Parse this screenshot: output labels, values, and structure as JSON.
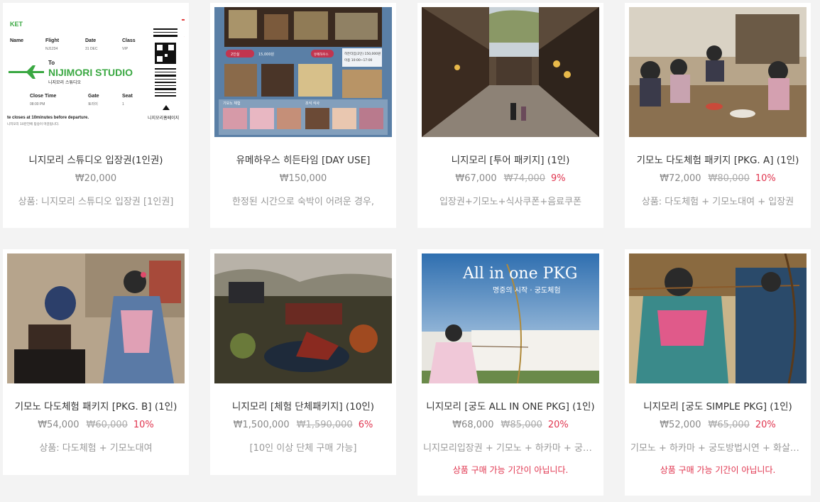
{
  "products": [
    {
      "title": "니지모리 스튜디오 입장권(1인권)",
      "price": "₩20,000",
      "original_price": "",
      "discount": "",
      "description": "상품: 니지모리 스튜디오 입장권 [1인권]",
      "notice": "",
      "image": {
        "ticket_header": "KET",
        "labels": [
          "Name",
          "Flight",
          "Date",
          "Class"
        ],
        "values": [
          "NJ1234",
          "31 DEC",
          "VIP"
        ],
        "to_label": "To",
        "studio_name": "NIJIMORI STUDIO",
        "studio_name_kr": "니지모리 스튜디오",
        "labels2": [
          "Close Time",
          "Gate",
          "Seat"
        ],
        "values2": [
          "08:00 PM",
          "토리이",
          "1"
        ],
        "footer": "te closes at 10minutes before departure.",
        "footer2": "니지모리 10분전에 탑승이 마감됩니다.",
        "qr_caption": "니지모리홈페이지"
      }
    },
    {
      "title": "유메하우스 히든타임 [DAY USE]",
      "price": "₩150,000",
      "original_price": "",
      "discount": "",
      "description": "한정된 시간으로 숙박이 어려운 경우,",
      "notice": "",
      "image": {
        "tag1": "2인실",
        "tag1_price": "15,000원",
        "tag2": "유메하우스",
        "info_line1": "히든타임(2인) 150,000원",
        "info_line2": "이용 10:00~17:00",
        "section1": "기모노 체험",
        "section2": "조식 식사"
      }
    },
    {
      "title": "니지모리 [투어 패키지] (1인)",
      "price": "₩67,000",
      "original_price": "₩74,000",
      "discount": "9%",
      "description": "입장권+기모노+식사쿠폰+음료쿠폰",
      "notice": ""
    },
    {
      "title": "기모노 다도체험 패키지 [PKG. A] (1인)",
      "price": "₩72,000",
      "original_price": "₩80,000",
      "discount": "10%",
      "description": "상품: 다도체험 + 기모노대여 + 입장권",
      "notice": ""
    },
    {
      "title": "기모노 다도체험 패키지 [PKG. B] (1인)",
      "price": "₩54,000",
      "original_price": "₩60,000",
      "discount": "10%",
      "description": "상품: 다도체험 + 기모노대여",
      "notice": ""
    },
    {
      "title": "니지모리 [체험 단체패키지] (10인)",
      "price": "₩1,500,000",
      "original_price": "₩1,590,000",
      "discount": "6%",
      "description": "[10인 이상 단체 구매 가능]",
      "notice": ""
    },
    {
      "title": "니지모리 [궁도 ALL IN ONE PKG] (1인)",
      "price": "₩68,000",
      "original_price": "₩85,000",
      "discount": "20%",
      "description": "니지모리입장권 + 기모노 + 하카마 + 궁도…",
      "notice": "상품 구매 가능 기간이 아닙니다.",
      "image": {
        "headline": "All in one PKG",
        "subline": "명중의 시작 · 궁도체험"
      }
    },
    {
      "title": "니지모리 [궁도 SIMPLE PKG] (1인)",
      "price": "₩52,000",
      "original_price": "₩65,000",
      "discount": "20%",
      "description": "기모노 + 하카마 + 궁도방법시연 + 화살1…",
      "notice": "상품 구매 가능 기간이 아닙니다."
    }
  ],
  "colors": {
    "background": "#f3f3f3",
    "card": "#ffffff",
    "discount": "#e0344e",
    "text": "#333333",
    "muted": "#999999",
    "studio_green": "#3aa842"
  }
}
